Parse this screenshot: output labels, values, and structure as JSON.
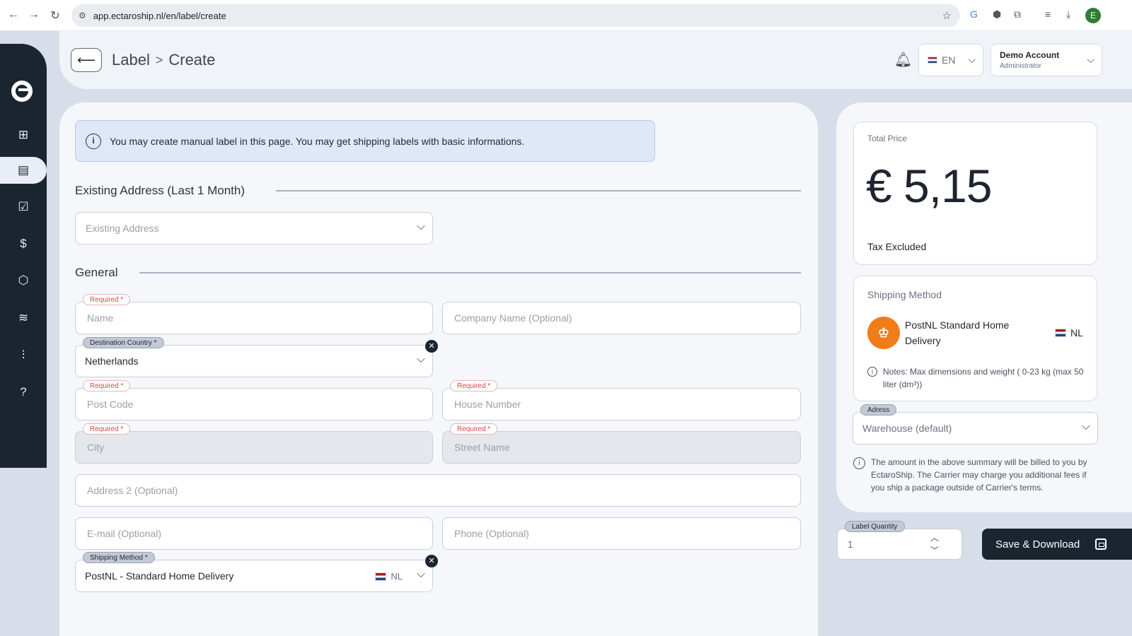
{
  "browser": {
    "url": "app.ectaroship.nl/en/label/create",
    "profile_initial": "E"
  },
  "header": {
    "breadcrumb": [
      "Label",
      "Create"
    ],
    "language": "EN",
    "account_name": "Demo Account",
    "account_role": "Administrator"
  },
  "sidebar": {
    "items": [
      {
        "name": "dashboard",
        "icon": "grid-icon"
      },
      {
        "name": "labels",
        "icon": "document-icon",
        "active": true
      },
      {
        "name": "orders",
        "icon": "clipboard-check-icon"
      },
      {
        "name": "invoices",
        "icon": "dollar-document-icon"
      },
      {
        "name": "packages",
        "icon": "box-icon"
      },
      {
        "name": "layers",
        "icon": "layers-icon"
      },
      {
        "name": "settings",
        "icon": "sliders-icon"
      },
      {
        "name": "help",
        "icon": "help-icon"
      }
    ]
  },
  "info_message": "You may create manual label in this page. You may get shipping labels with basic informations.",
  "existing_address": {
    "section_title": "Existing Address (Last 1 Month)",
    "placeholder": "Existing Address"
  },
  "general": {
    "section_title": "General",
    "required_tag": "Required *",
    "name_placeholder": "Name",
    "company_placeholder": "Company Name (Optional)",
    "destination_label": "Destination Country *",
    "destination_value": "Netherlands",
    "postcode_placeholder": "Post Code",
    "house_number_placeholder": "House Number",
    "city_placeholder": "City",
    "street_placeholder": "Street Name",
    "address2_placeholder": "Address 2 (Optional)",
    "email_placeholder": "E-mail (Optional)",
    "phone_placeholder": "Phone (Optional)",
    "shipping_method_label": "Shipping Method *",
    "shipping_method_value": "PostNL - Standard Home Delivery",
    "shipping_method_country": "NL"
  },
  "summary": {
    "total_price_label": "Total Price",
    "total_price_value": "€ 5,15",
    "tax_note": "Tax Excluded",
    "shipping_method_title": "Shipping Method",
    "carrier_name": "PostNL Standard Home Delivery",
    "carrier_country": "NL",
    "carrier_notes": "Notes: Max dimensions and weight ( 0-23 kg (max 50 liter (dm³))",
    "address_label": "Adress",
    "address_value": "Warehouse (default)",
    "billing_note": "The amount in the above summary will be billed to you by EctaroShip. The Carrier may charge you additional fees if you ship a package outside of Carrier's terms."
  },
  "actions": {
    "quantity_label": "Label Quantity",
    "quantity_value": "1",
    "save_label": "Save & Download"
  },
  "colors": {
    "sidebar": "#1b2530",
    "required": "#d64545",
    "postnl_orange": "#f07d18"
  }
}
